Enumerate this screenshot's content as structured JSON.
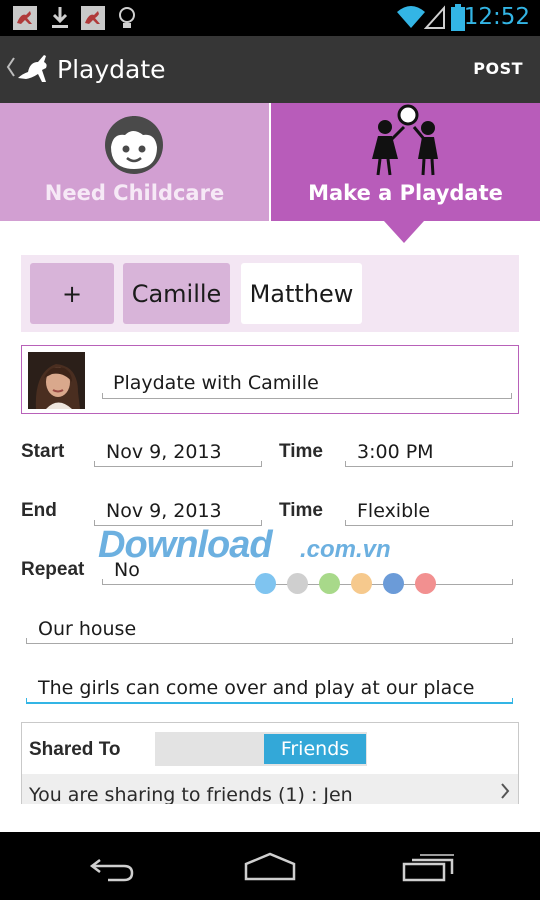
{
  "status_bar": {
    "time": "12:52",
    "icons": [
      "kangaroo-app-icon",
      "download-icon",
      "kangaroo-app-icon",
      "lightbulb-icon",
      "wifi-icon",
      "signal-icon",
      "battery-icon"
    ]
  },
  "action_bar": {
    "title": "Playdate",
    "post_label": "POST",
    "icons": [
      "back-chevron-icon",
      "kangaroo-logo-icon"
    ]
  },
  "mode_tabs": [
    {
      "label": "Need Childcare",
      "selected": false,
      "icon": "child-face-icon"
    },
    {
      "label": "Make a Playdate",
      "selected": true,
      "icon": "kids-playing-ball-icon"
    }
  ],
  "children": {
    "add_label": "+",
    "chips": [
      {
        "label": "Camille",
        "selected": true
      },
      {
        "label": "Matthew",
        "selected": false
      }
    ]
  },
  "event": {
    "title_value": "Playdate with Camille",
    "start_label": "Start",
    "start_date": "Nov 9, 2013",
    "start_time_label": "Time",
    "start_time": "3:00 PM",
    "end_label": "End",
    "end_date": "Nov 9, 2013",
    "end_time_label": "Time",
    "end_time": "Flexible",
    "repeat_label": "Repeat",
    "repeat_value": "No",
    "location_value": "Our house",
    "notes_value": "The girls can come over and play at our place"
  },
  "sharing": {
    "label": "Shared To",
    "toggle_value": "Friends",
    "summary": "You are sharing to friends (1) : Jen"
  },
  "watermark": {
    "text_main": "Download",
    "text_domain": ".com.vn",
    "dot_colors": [
      "#7fc4f0",
      "#cfcfcf",
      "#a8d98a",
      "#f6c98d",
      "#6b9bd8",
      "#f29090"
    ]
  },
  "nav_bar": {
    "icons": [
      "back-icon",
      "home-icon",
      "recent-apps-icon"
    ]
  },
  "colors": {
    "tab_need": "#d29fd2",
    "tab_make": "#b85cba",
    "accent": "#33b5e5",
    "chip_selected": "#d8b4d9"
  }
}
